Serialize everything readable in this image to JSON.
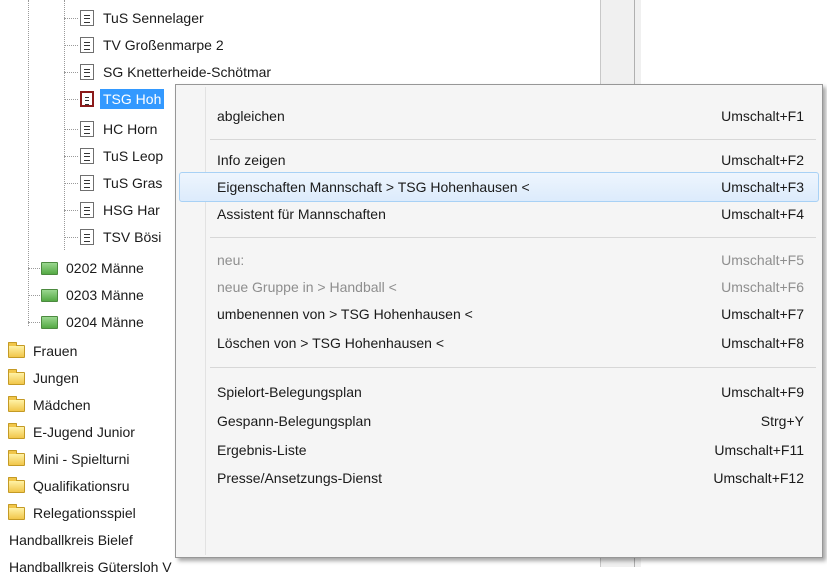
{
  "tree": {
    "teams": [
      {
        "label": "TuS Sennelager"
      },
      {
        "label": "TV Großenmarpe 2"
      },
      {
        "label": "SG Knetterheide-Schötmar"
      },
      {
        "label": "TSG Hoh"
      },
      {
        "label": "HC Horn"
      },
      {
        "label": "TuS Leop"
      },
      {
        "label": "TuS Gras"
      },
      {
        "label": "HSG Har"
      },
      {
        "label": "TSV Bösi"
      }
    ],
    "groups": [
      {
        "label": "0202 Männe"
      },
      {
        "label": "0203 Männe"
      },
      {
        "label": "0204 Männe"
      }
    ],
    "folders": [
      {
        "label": "Frauen"
      },
      {
        "label": "Jungen"
      },
      {
        "label": "Mädchen"
      },
      {
        "label": "E-Jugend Junior"
      },
      {
        "label": "Mini - Spielturni"
      },
      {
        "label": "Qualifikationsru"
      },
      {
        "label": "Relegationsspiel"
      }
    ],
    "roots": [
      {
        "label": "Handballkreis Bielef"
      },
      {
        "label": "Handballkreis Gütersloh V"
      }
    ]
  },
  "menu": {
    "items": [
      {
        "label": "abgleichen",
        "shortcut": "Umschalt+F1"
      },
      {
        "label": "Info zeigen",
        "shortcut": "Umschalt+F2"
      },
      {
        "label": "Eigenschaften Mannschaft  > TSG Hohenhausen <",
        "shortcut": "Umschalt+F3"
      },
      {
        "label": "Assistent für Mannschaften",
        "shortcut": "Umschalt+F4"
      },
      {
        "label": "neu:",
        "shortcut": "Umschalt+F5"
      },
      {
        "label": "neue Gruppe in  > Handball <",
        "shortcut": "Umschalt+F6"
      },
      {
        "label": "umbenennen von  > TSG Hohenhausen <",
        "shortcut": "Umschalt+F7"
      },
      {
        "label": "Löschen von  > TSG Hohenhausen <",
        "shortcut": "Umschalt+F8"
      },
      {
        "label": "Spielort-Belegungsplan",
        "shortcut": "Umschalt+F9"
      },
      {
        "label": "Gespann-Belegungsplan",
        "shortcut": "Strg+Y"
      },
      {
        "label": "Ergebnis-Liste",
        "shortcut": "Umschalt+F11"
      },
      {
        "label": "Presse/Ansetzungs-Dienst",
        "shortcut": "Umschalt+F12"
      }
    ]
  }
}
